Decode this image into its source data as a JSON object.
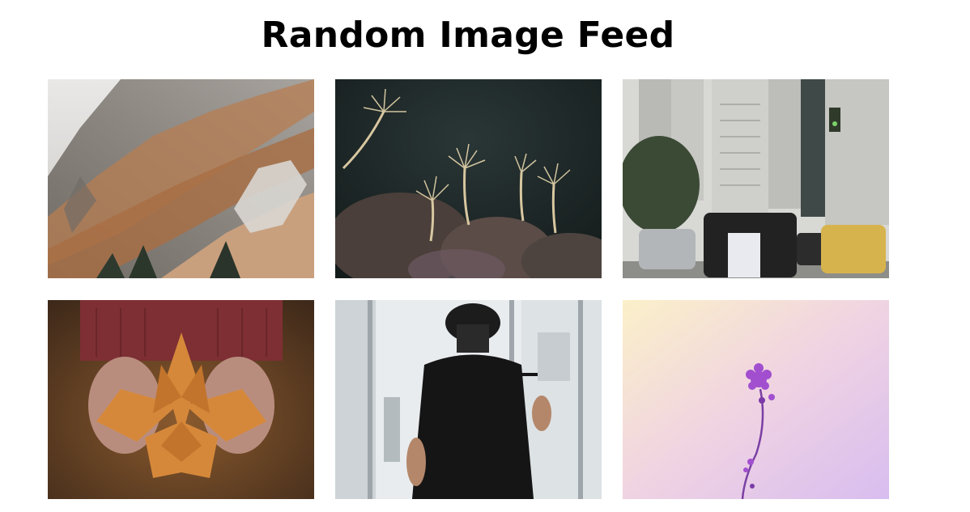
{
  "page": {
    "title": "Random Image Feed"
  },
  "feed": {
    "images": [
      {
        "subject": "mountain-slope",
        "colors": [
          "#d9d6d2",
          "#8a8580",
          "#c48a5a"
        ]
      },
      {
        "subject": "feather-duster-worms",
        "colors": [
          "#1f2a2a",
          "#d9c8a0",
          "#5a4a44"
        ]
      },
      {
        "subject": "city-street-traffic",
        "colors": [
          "#c9c9c6",
          "#3a3a3a",
          "#d9b04a"
        ]
      },
      {
        "subject": "hands-holding-autumn-leaves",
        "colors": [
          "#7a2e2e",
          "#d68a3a",
          "#3a2a22"
        ]
      },
      {
        "subject": "police-officer-back",
        "colors": [
          "#e6eaed",
          "#151515",
          "#9aa3aa"
        ]
      },
      {
        "subject": "purple-flower-pastel",
        "colors": [
          "#f6ecc7",
          "#e3c6ea",
          "#9b4fc8"
        ]
      }
    ]
  }
}
